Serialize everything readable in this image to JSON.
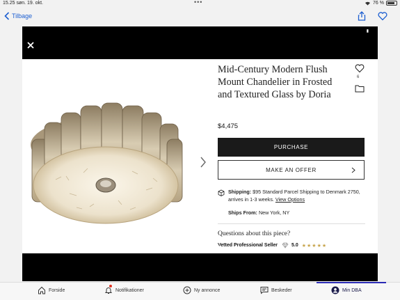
{
  "status_bar": {
    "time": "15.25",
    "date": "søn. 19. okt.",
    "dots": "•••",
    "battery": "76 %"
  },
  "navbar": {
    "back_label": "Tilbage",
    "icons": [
      "share-icon",
      "heart-icon"
    ],
    "accent_color": "#1d5fd1"
  },
  "viewer": {
    "close_icon": "close-icon",
    "pager": "6 / 8"
  },
  "product": {
    "title": "Mid-Century Modern Flush Mount Chandelier in Frosted and Textured Glass by Doria",
    "price": "$4,475",
    "favorite_count": "6",
    "purchase_label": "PURCHASE",
    "offer_label": "MAKE AN OFFER",
    "shipping_label": "Shipping:",
    "shipping_text": "$95 Standard Parcel Shipping to Denmark 2750, arrives in 1-3 weeks.",
    "view_options": "View Options",
    "ships_from_label": "Ships From:",
    "ships_from_value": "New York, NY",
    "questions": "Questions about this piece?",
    "seller_label": "Vetted Professional Seller",
    "rating": "5.0",
    "stars": 5,
    "star_color": "#c7a44b"
  },
  "tabbar": {
    "items": [
      {
        "label": "Forside",
        "icon": "home-icon"
      },
      {
        "label": "Notifikationer",
        "icon": "bell-icon"
      },
      {
        "label": "Ny annonce",
        "icon": "plus-circle-icon"
      },
      {
        "label": "Beskeder",
        "icon": "message-icon"
      },
      {
        "label": "Min DBA",
        "icon": "profile-icon"
      }
    ],
    "active_index": 4
  }
}
